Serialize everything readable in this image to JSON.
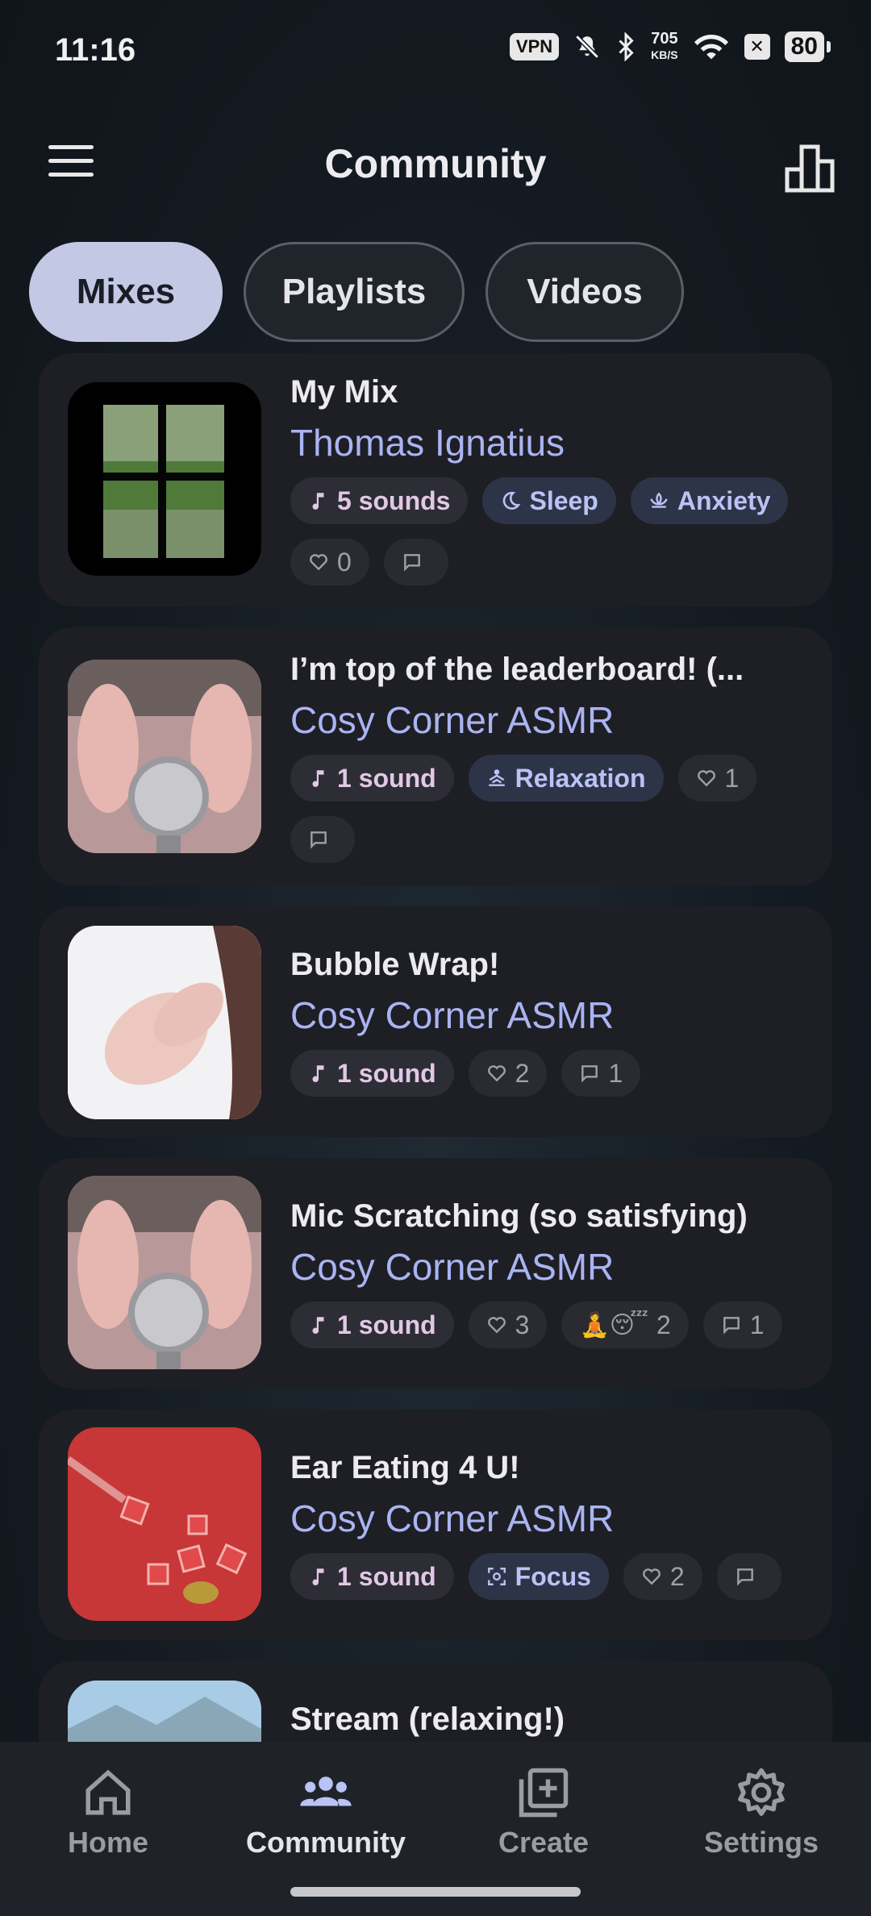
{
  "status_bar": {
    "time": "11:16",
    "vpn": "VPN",
    "speed_value": "705",
    "speed_unit": "KB/S",
    "battery": "80"
  },
  "header": {
    "title": "Community"
  },
  "tabs": [
    {
      "label": "Mixes",
      "active": true
    },
    {
      "label": "Playlists",
      "active": false
    },
    {
      "label": "Videos",
      "active": false
    }
  ],
  "mixes": [
    {
      "title": "My Mix",
      "author": "Thomas Ignatius",
      "sounds": "5 sounds",
      "tags": [
        "Sleep",
        "Anxiety"
      ],
      "likes": "0",
      "comments": ""
    },
    {
      "title": "I’m top of the leaderboard! (...",
      "author": "Cosy Corner ASMR",
      "sounds": "1 sound",
      "tags": [
        "Relaxation"
      ],
      "likes": "1",
      "comments": ""
    },
    {
      "title": "Bubble Wrap!",
      "author": "Cosy Corner ASMR",
      "sounds": "1 sound",
      "likes": "2",
      "comments": "1"
    },
    {
      "title": "Mic Scratching (so satisfying)",
      "author": "Cosy Corner ASMR",
      "sounds": "1 sound",
      "likes": "3",
      "reactions": "🧘😴",
      "reaction_count": "2",
      "comments": "1"
    },
    {
      "title": "Ear Eating 4 U!",
      "author": "Cosy Corner ASMR",
      "sounds": "1 sound",
      "tags": [
        "Focus"
      ],
      "likes": "2",
      "comments": ""
    },
    {
      "title": "Stream (relaxing!)"
    }
  ],
  "bottom_nav": [
    {
      "label": "Home",
      "icon": "home-icon",
      "active": false
    },
    {
      "label": "Community",
      "icon": "community-icon",
      "active": true
    },
    {
      "label": "Create",
      "icon": "create-icon",
      "active": false
    },
    {
      "label": "Settings",
      "icon": "settings-icon",
      "active": false
    }
  ],
  "colors": {
    "accent": "#aab4f2",
    "active_tab": "#c3c8e4",
    "card": "#1e1f25"
  }
}
